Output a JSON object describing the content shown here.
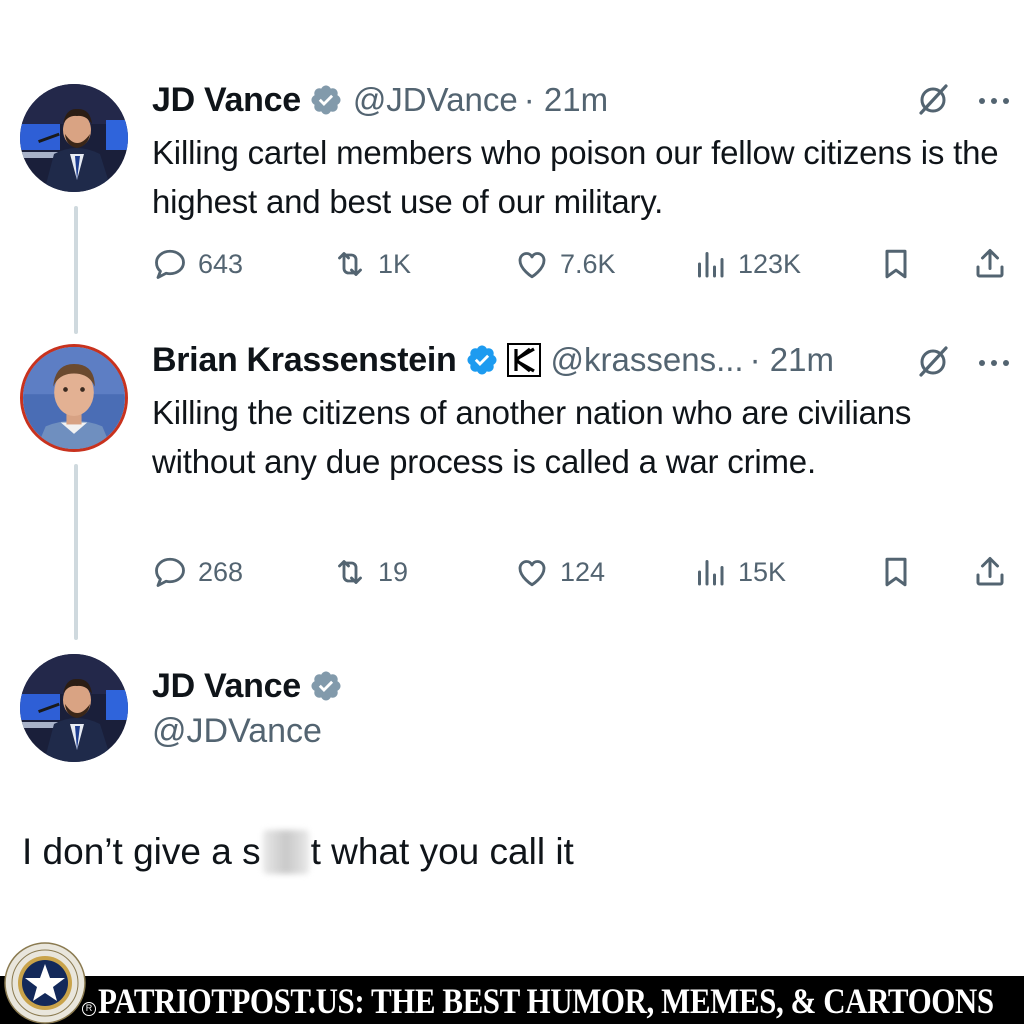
{
  "tweets": [
    {
      "name": "JD Vance",
      "handle": "@JDVance",
      "time": "· 21m",
      "text": "Killing cartel members who poison our fellow citizens is the highest and best use of our military.",
      "replies": "643",
      "reposts": "1K",
      "likes": "7.6K",
      "views": "123K"
    },
    {
      "name": "Brian Krassenstein",
      "handle": "@krassens...",
      "time": "· 21m",
      "text": "Killing the citizens of another nation who are civilians without any due process is called a war crime.",
      "replies": "268",
      "reposts": "19",
      "likes": "124",
      "views": "15K"
    }
  ],
  "reply": {
    "name": "JD Vance",
    "handle": "@JDVance",
    "text_before": "I don’t give a s",
    "text_after": "t what you call it"
  },
  "footer": {
    "text": "PATRIOTPOST.US: THE BEST HUMOR, MEMES, & CARTOONS",
    "registered": "R"
  },
  "colors": {
    "verified_blue": "#1d9bf0",
    "verified_gray": "#829aab",
    "muted": "#536471",
    "thread_line": "#cfd9de"
  },
  "icons": {
    "reply": "speech-bubble-icon",
    "repost": "repost-arrows-icon",
    "like": "heart-icon",
    "views": "bar-chart-icon",
    "bookmark": "bookmark-icon",
    "share": "share-upload-icon",
    "grok": "grok-slash-icon",
    "more": "ellipsis-icon"
  }
}
